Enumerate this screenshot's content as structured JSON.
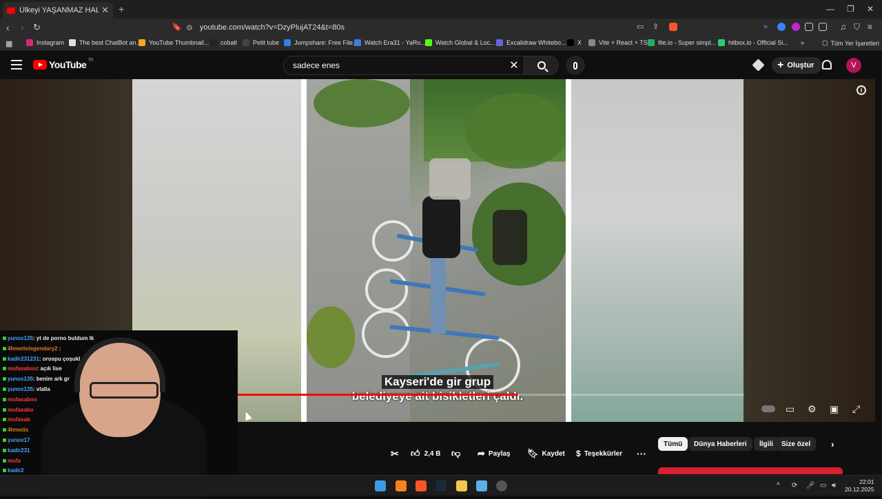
{
  "browser": {
    "tab_title": "Ülkeyi YAŞANMAZ HALE Getirdi",
    "url": "youtube.com/watch?v=DzyPlujAT24&t=80s",
    "bookmarks": [
      {
        "label": "Instagram",
        "color": "#d62976"
      },
      {
        "label": "The best ChatBot an...",
        "color": "#e0e0e0"
      },
      {
        "label": "YouTube Thumbnail...",
        "color": "#f5a623"
      },
      {
        "label": "cobalt",
        "color": "#222222"
      },
      {
        "label": "Petit tube",
        "color": "#444444"
      },
      {
        "label": "Jumpshare: Free File...",
        "color": "#2f80ed"
      },
      {
        "label": "Watch Era31 - YaRo...",
        "color": "#3b7ddd"
      },
      {
        "label": "Watch Global & Loc...",
        "color": "#53fc18"
      },
      {
        "label": "Excalidraw Whitebo...",
        "color": "#6965db"
      },
      {
        "label": "X",
        "color": "#000000"
      },
      {
        "label": "Vite + React + TS",
        "color": "#888888"
      },
      {
        "label": "file.io - Super simpl...",
        "color": "#27ae60"
      },
      {
        "label": "hitbox.io - Official Si...",
        "color": "#2ecc71"
      }
    ],
    "all_bookmarks": "Tüm Yer İşaretleri"
  },
  "youtube": {
    "logo_text": "YouTube",
    "region": "TR",
    "search_value": "sadece enes",
    "create_label": "Oluştur",
    "avatar_letter": "V"
  },
  "video": {
    "caption_line1": "Kayseri'de gir grup",
    "caption_line2": "belediyeye ait bisikletleri çaldı.",
    "progress": 0.61
  },
  "chat": [
    {
      "user": "yunox135",
      "msg": ": yt de porno buldum lk",
      "color": "u"
    },
    {
      "user": "4hmetislegendary2",
      "msg": " :",
      "color": "u o"
    },
    {
      "user": "kadir231231",
      "msg": ": orospu çoşukl",
      "color": "u"
    },
    {
      "user": "mufasaboo",
      "msg": ": açık lise",
      "color": "u r"
    },
    {
      "user": "yunox135",
      "msg": ": benim ark gr",
      "color": "u"
    },
    {
      "user": "yunox135",
      "msg": ": vlalla",
      "color": "u"
    },
    {
      "user": "mufasaboo",
      "msg": "",
      "color": "u r"
    },
    {
      "user": "mufasabo",
      "msg": "",
      "color": "u r"
    },
    {
      "user": "mufasab",
      "msg": "",
      "color": "u r"
    },
    {
      "user": "4hmetis",
      "msg": "",
      "color": "u o"
    },
    {
      "user": "yunox17",
      "msg": "",
      "color": "u"
    },
    {
      "user": "kadir231",
      "msg": "",
      "color": "u"
    },
    {
      "user": "mufa",
      "msg": "",
      "color": "u r"
    },
    {
      "user": "kadir2",
      "msg": "",
      "color": "u"
    }
  ],
  "actions": {
    "likes": "2,4 B",
    "share": "Paylaş",
    "save": "Kaydet",
    "thanks": "Teşekkürler",
    "more": "···"
  },
  "chips": [
    "Tümü",
    "Dünya Haberleri",
    "İlgili",
    "Size özel"
  ],
  "taskbar": {
    "time": "22:01",
    "date": "20.12.2025"
  }
}
